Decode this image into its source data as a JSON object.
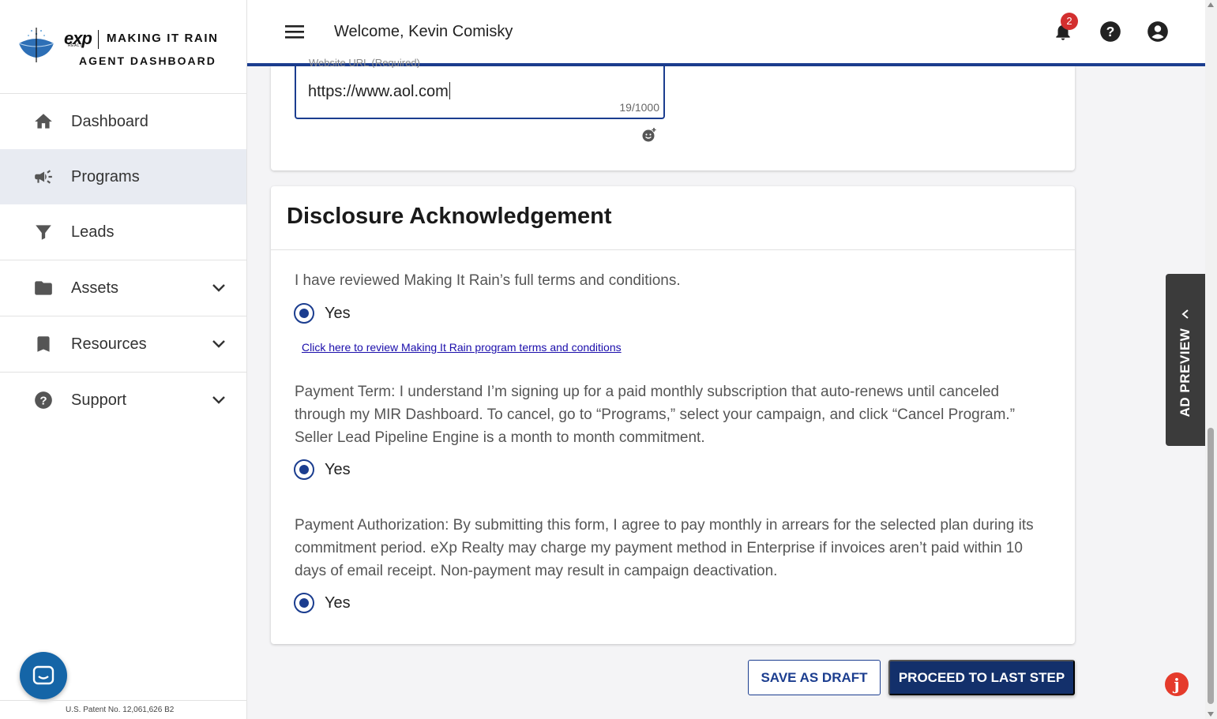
{
  "brand": {
    "exp": "exp",
    "realty": "REALTY",
    "line1": "MAKING IT RAIN",
    "line2": "AGENT DASHBOARD"
  },
  "sidebar": {
    "items": [
      {
        "label": "Dashboard",
        "icon": "home-icon"
      },
      {
        "label": "Programs",
        "icon": "megaphone-icon",
        "active": true
      },
      {
        "label": "Leads",
        "icon": "funnel-icon"
      },
      {
        "label": "Assets",
        "icon": "folder-icon",
        "expandable": true
      },
      {
        "label": "Resources",
        "icon": "bookmark-icon",
        "expandable": true
      },
      {
        "label": "Support",
        "icon": "help-circle-icon",
        "expandable": true
      }
    ],
    "patent": "U.S. Patent No. 12,061,626 B2"
  },
  "header": {
    "welcome": "Welcome, Kevin Comisky",
    "notification_count": "2"
  },
  "website_field": {
    "label": "Website URL (Required)",
    "value": "https://www.aol.com",
    "counter": "19/1000"
  },
  "disclosure": {
    "title": "Disclosure Acknowledgement",
    "questions": [
      {
        "text": "I have reviewed Making It Rain’s full terms and conditions.",
        "answer": "Yes"
      },
      {
        "text": "Payment Term: I understand I’m signing up for a paid monthly subscription that auto-renews until canceled through my MIR Dashboard. To cancel, go to “Programs,” select your campaign, and click “Cancel Program.” Seller Lead Pipeline Engine is a month to month commitment.",
        "answer": "Yes"
      },
      {
        "text": "Payment Authorization: By submitting this form, I agree to pay monthly in arrears for the selected plan during its commitment period. eXp Realty may charge my payment method in Enterprise if invoices aren’t paid within 10 days of email receipt. Non-payment may result in campaign deactivation.",
        "answer": "Yes"
      }
    ],
    "terms_link": "Click here to review Making It Rain program terms and conditions"
  },
  "actions": {
    "save_draft": "SAVE AS DRAFT",
    "proceed": "PROCEED TO LAST STEP"
  },
  "ad_preview": {
    "label": "AD PREVIEW"
  },
  "widget": {
    "j_label": "j"
  },
  "colors": {
    "primary": "#1b3d8f",
    "primary_dark": "#13306b",
    "badge": "#d32f2f",
    "active_nav": "#e8ebf2"
  }
}
